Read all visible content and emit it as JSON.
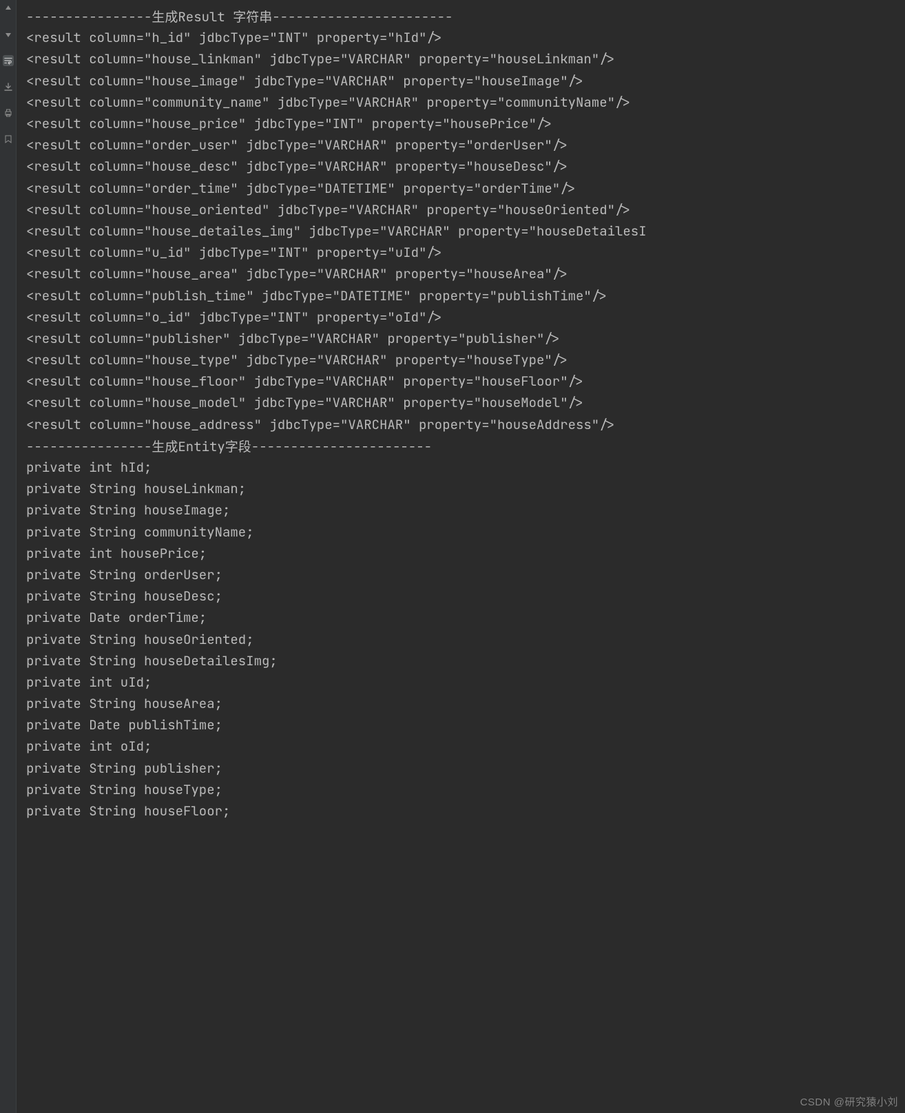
{
  "headerResult": "----------------生成Result 字符串-----------------------",
  "results": [
    {
      "column": "h_id",
      "jdbcType": "INT",
      "property": "hId"
    },
    {
      "column": "house_linkman",
      "jdbcType": "VARCHAR",
      "property": "houseLinkman"
    },
    {
      "column": "house_image",
      "jdbcType": "VARCHAR",
      "property": "houseImage"
    },
    {
      "column": "community_name",
      "jdbcType": "VARCHAR",
      "property": "communityName"
    },
    {
      "column": "house_price",
      "jdbcType": "INT",
      "property": "housePrice"
    },
    {
      "column": "order_user",
      "jdbcType": "VARCHAR",
      "property": "orderUser"
    },
    {
      "column": "house_desc",
      "jdbcType": "VARCHAR",
      "property": "houseDesc"
    },
    {
      "column": "order_time",
      "jdbcType": "DATETIME",
      "property": "orderTime"
    },
    {
      "column": "house_oriented",
      "jdbcType": "VARCHAR",
      "property": "houseOriented"
    },
    {
      "column": "house_detailes_img",
      "jdbcType": "VARCHAR",
      "property": "houseDetailesI"
    },
    {
      "column": "u_id",
      "jdbcType": "INT",
      "property": "uId"
    },
    {
      "column": "house_area",
      "jdbcType": "VARCHAR",
      "property": "houseArea"
    },
    {
      "column": "publish_time",
      "jdbcType": "DATETIME",
      "property": "publishTime"
    },
    {
      "column": "o_id",
      "jdbcType": "INT",
      "property": "oId"
    },
    {
      "column": "publisher",
      "jdbcType": "VARCHAR",
      "property": "publisher"
    },
    {
      "column": "house_type",
      "jdbcType": "VARCHAR",
      "property": "houseType"
    },
    {
      "column": "house_floor",
      "jdbcType": "VARCHAR",
      "property": "houseFloor"
    },
    {
      "column": "house_model",
      "jdbcType": "VARCHAR",
      "property": "houseModel"
    },
    {
      "column": "house_address",
      "jdbcType": "VARCHAR",
      "property": "houseAddress"
    }
  ],
  "headerEntity": "----------------生成Entity字段-----------------------",
  "fields": [
    {
      "type": "int",
      "name": "hId"
    },
    {
      "type": "String",
      "name": "houseLinkman"
    },
    {
      "type": "String",
      "name": "houseImage"
    },
    {
      "type": "String",
      "name": "communityName"
    },
    {
      "type": "int",
      "name": "housePrice"
    },
    {
      "type": "String",
      "name": "orderUser"
    },
    {
      "type": "String",
      "name": "houseDesc"
    },
    {
      "type": "Date",
      "name": "orderTime"
    },
    {
      "type": "String",
      "name": "houseOriented"
    },
    {
      "type": "String",
      "name": "houseDetailesImg"
    },
    {
      "type": "int",
      "name": "uId"
    },
    {
      "type": "String",
      "name": "houseArea"
    },
    {
      "type": "Date",
      "name": "publishTime"
    },
    {
      "type": "int",
      "name": "oId"
    },
    {
      "type": "String",
      "name": "publisher"
    },
    {
      "type": "String",
      "name": "houseType"
    },
    {
      "type": "String",
      "name": "houseFloor"
    }
  ],
  "watermark": "CSDN @研究猿小刘",
  "gutterIcons": [
    "arrow-up",
    "arrow-down",
    "wrap",
    "download",
    "printer",
    "bookmark"
  ]
}
